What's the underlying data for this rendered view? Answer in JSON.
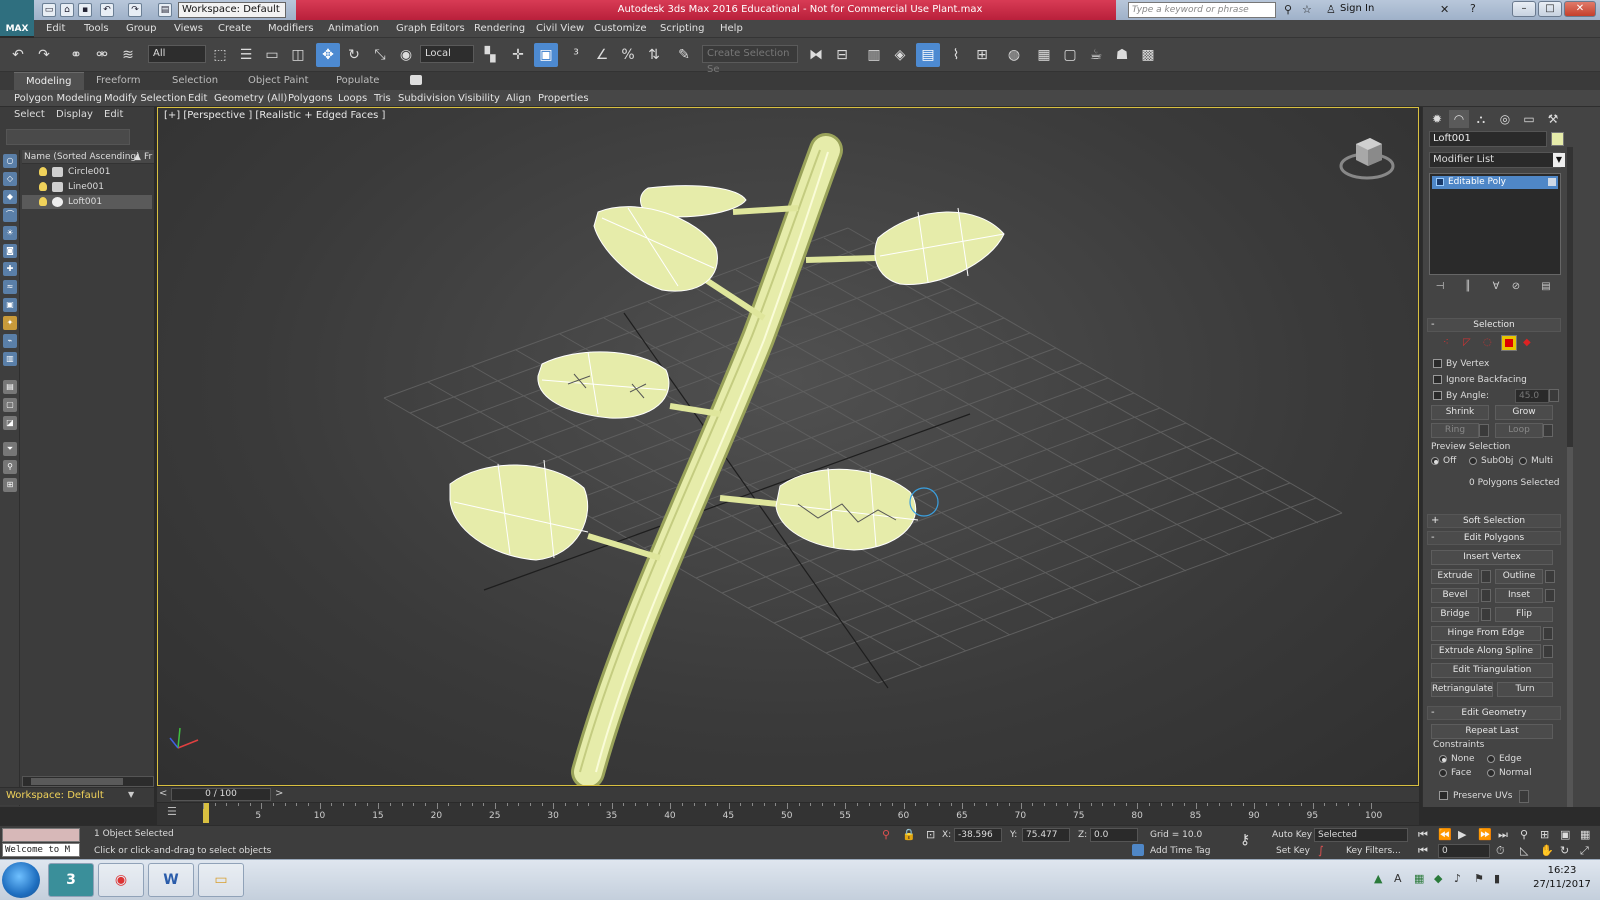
{
  "title_bar": {
    "logo": "MAX",
    "workspace": "Workspace: Default",
    "app_title": "Autodesk 3ds Max 2016 Educational - Not for Commercial Use    Plant.max",
    "search_placeholder": "Type a keyword or phrase",
    "sign_in": "Sign In"
  },
  "menus": [
    "Edit",
    "Tools",
    "Group",
    "Views",
    "Create",
    "Modifiers",
    "Animation",
    "Graph Editors",
    "Rendering",
    "Civil View",
    "Customize",
    "Scripting",
    "Help"
  ],
  "toolbar": {
    "selection_filter": "All",
    "ref_coord": "Local",
    "named_selection_placeholder": "Create Selection Se"
  },
  "ribbon": {
    "tabs": [
      "Modeling",
      "Freeform",
      "Selection",
      "Object Paint",
      "Populate"
    ],
    "sub_items": [
      "Polygon Modeling",
      "Modify Selection",
      "Edit",
      "Geometry (All)",
      "Polygons",
      "Loops",
      "Tris",
      "Subdivision",
      "Visibility",
      "Align",
      "Properties"
    ]
  },
  "scene_explorer": {
    "tabs": [
      "Select",
      "Display",
      "Edit"
    ],
    "column_header": "Name (Sorted Ascending)",
    "column2": "Fr",
    "items": [
      "Circle001",
      "Line001",
      "Loft001"
    ]
  },
  "viewport": {
    "label": "[+] [Perspective ] [Realistic + Edged Faces ]"
  },
  "command_panel": {
    "object_name": "Loft001",
    "modifier_list": "Modifier List",
    "stack_item": "Editable Poly",
    "selection_rollout": "Selection",
    "by_vertex": "By Vertex",
    "ignore_backfacing": "Ignore Backfacing",
    "by_angle": "By Angle:",
    "by_angle_value": "45.0",
    "shrink": "Shrink",
    "grow": "Grow",
    "ring": "Ring",
    "loop": "Loop",
    "preview_selection": "Preview Selection",
    "preview_off": "Off",
    "preview_subobj": "SubObj",
    "preview_multi": "Multi",
    "polys_selected": "0 Polygons Selected",
    "soft_selection": "Soft Selection",
    "edit_polygons": "Edit Polygons",
    "insert_vertex": "Insert Vertex",
    "extrude": "Extrude",
    "outline": "Outline",
    "bevel": "Bevel",
    "inset": "Inset",
    "bridge": "Bridge",
    "flip": "Flip",
    "hinge_from_edge": "Hinge From Edge",
    "extrude_along_spline": "Extrude Along Spline",
    "edit_triangulation": "Edit Triangulation",
    "retriangulate": "Retriangulate",
    "turn": "Turn",
    "edit_geometry": "Edit Geometry",
    "repeat_last": "Repeat Last",
    "constraints": "Constraints",
    "c_none": "None",
    "c_edge": "Edge",
    "c_face": "Face",
    "c_normal": "Normal",
    "preserve_uvs": "Preserve UVs"
  },
  "timeline": {
    "frame_display": "0 / 100",
    "ticks": [
      "5",
      "10",
      "15",
      "20",
      "25",
      "30",
      "35",
      "40",
      "45",
      "50",
      "55",
      "60",
      "65",
      "70",
      "75",
      "80",
      "85",
      "90",
      "95",
      "100"
    ]
  },
  "status": {
    "workspace": "Workspace: Default",
    "maxscript_listener": "Welcome to M",
    "objects_selected": "1 Object Selected",
    "prompt": "Click or click-and-drag to select objects",
    "x_label": "X:",
    "x_value": "-38.596",
    "y_label": "Y:",
    "y_value": "75.477",
    "z_label": "Z:",
    "z_value": "0.0",
    "grid": "Grid = 10.0",
    "add_time_tag": "Add Time Tag",
    "auto_key": "Auto Key",
    "set_key": "Set Key",
    "selected_combo": "Selected",
    "key_filters": "Key Filters...",
    "frame_field": "0"
  },
  "taskbar": {
    "time": "16:23",
    "date": "27/11/2017"
  },
  "colors": {
    "title_banner": "#c8304a",
    "viewport_border": "#d9c040",
    "leaf_fill": "#e6ecaa",
    "highlight": "#4f87c7"
  }
}
